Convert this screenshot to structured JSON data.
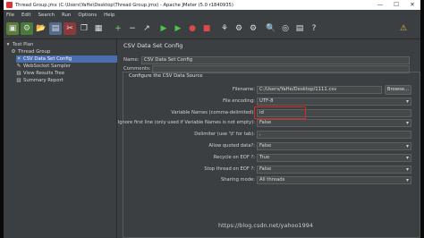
{
  "window": {
    "title": "Thread Group.jmx (C:\\Users\\YaHe\\Desktop\\Thread Group.jmx) - Apache JMeter (5.0 r1840935)",
    "controls": [
      "—",
      "☐",
      "✕"
    ]
  },
  "menu": [
    "File",
    "Edit",
    "Search",
    "Run",
    "Options",
    "Help"
  ],
  "tree": [
    {
      "label": "Test Plan",
      "icon": "test-plan-icon"
    },
    {
      "label": "Thread Group",
      "icon": "gear-icon"
    },
    {
      "label": "CSV Data Set Config",
      "icon": "config-icon"
    },
    {
      "label": "WebSocket Sampler",
      "icon": "pen-icon"
    },
    {
      "label": "View Results Tree",
      "icon": "chart-icon"
    },
    {
      "label": "Summary Report",
      "icon": "chart-icon"
    }
  ],
  "panel": {
    "title": "CSV Data Set Config",
    "name_label": "Name:",
    "name_value": "CSV Data Set Config",
    "comments_label": "Comments:",
    "group_title": "Configure the CSV Data Source",
    "browse_label": "Browse...",
    "fields": [
      {
        "label": "Filename:",
        "value": "C:/Users/YaHe/Desktop/1111.csv"
      },
      {
        "label": "File encoding:",
        "value": "UTF-8"
      },
      {
        "label": "Variable Names (comma-delimited):",
        "value": "id"
      },
      {
        "label": "Ignore first line (only used if Variable Names is not empty):",
        "value": "False"
      },
      {
        "label": "Delimiter (use '\\t' for tab):",
        "value": ","
      },
      {
        "label": "Allow quoted data?:",
        "value": "False"
      },
      {
        "label": "Recycle on EOF ?:",
        "value": "True"
      },
      {
        "label": "Stop thread on EOF ?:",
        "value": "False"
      },
      {
        "label": "Sharing mode:",
        "value": "All threads"
      }
    ]
  },
  "watermark": "https://blog.csdn.net/yahoo1994",
  "colors": {
    "background": "#3c3f41",
    "selection": "#4b6eaf",
    "highlight": "#e52525"
  }
}
